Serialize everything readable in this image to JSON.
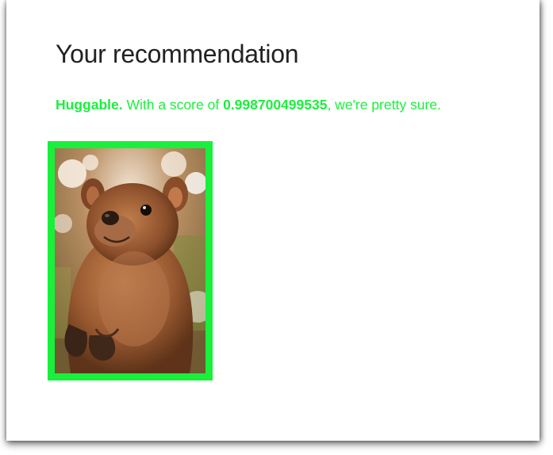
{
  "page": {
    "title": "Your recommendation"
  },
  "result": {
    "label": "Huggable.",
    "score_prefix": "With a score of",
    "score": "0.998700499535",
    "score_suffix": ", we're pretty sure."
  },
  "photo": {
    "subject": "quokka"
  },
  "colors": {
    "accent": "#19f03c",
    "title_text": "#222222",
    "background": "#ffffff"
  },
  "icons": {
    "photo": "quokka-photo"
  }
}
